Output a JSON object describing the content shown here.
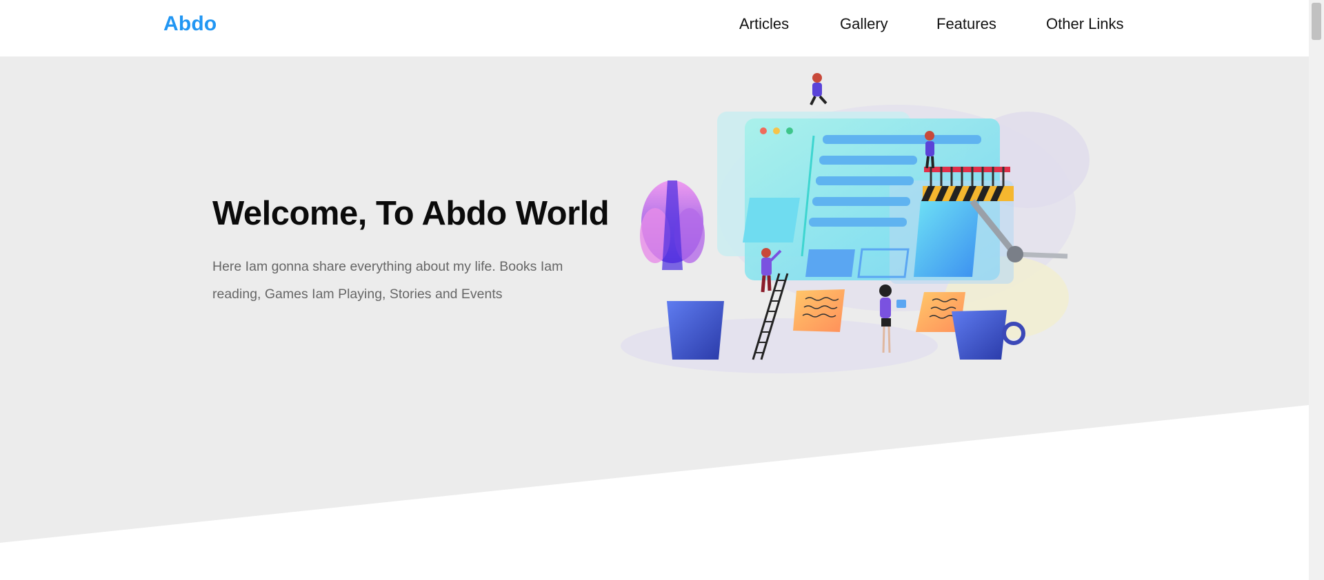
{
  "header": {
    "logo": "Abdo",
    "nav": [
      {
        "label": "Articles"
      },
      {
        "label": "Gallery"
      },
      {
        "label": "Features"
      },
      {
        "label": "Other Links"
      }
    ]
  },
  "landing": {
    "title": "Welcome, To Abdo World",
    "text": "Here Iam gonna share everything about my life. Books Iam reading, Games Iam Playing, Stories and Events",
    "illustration_icon": "web-builders-illustration",
    "go_down_icon": "double-chevron-down-icon"
  },
  "colors": {
    "accent": "#2196f3",
    "landing_bg": "#ececec",
    "text_dark": "#0b0b0b",
    "text_muted": "#666666"
  }
}
